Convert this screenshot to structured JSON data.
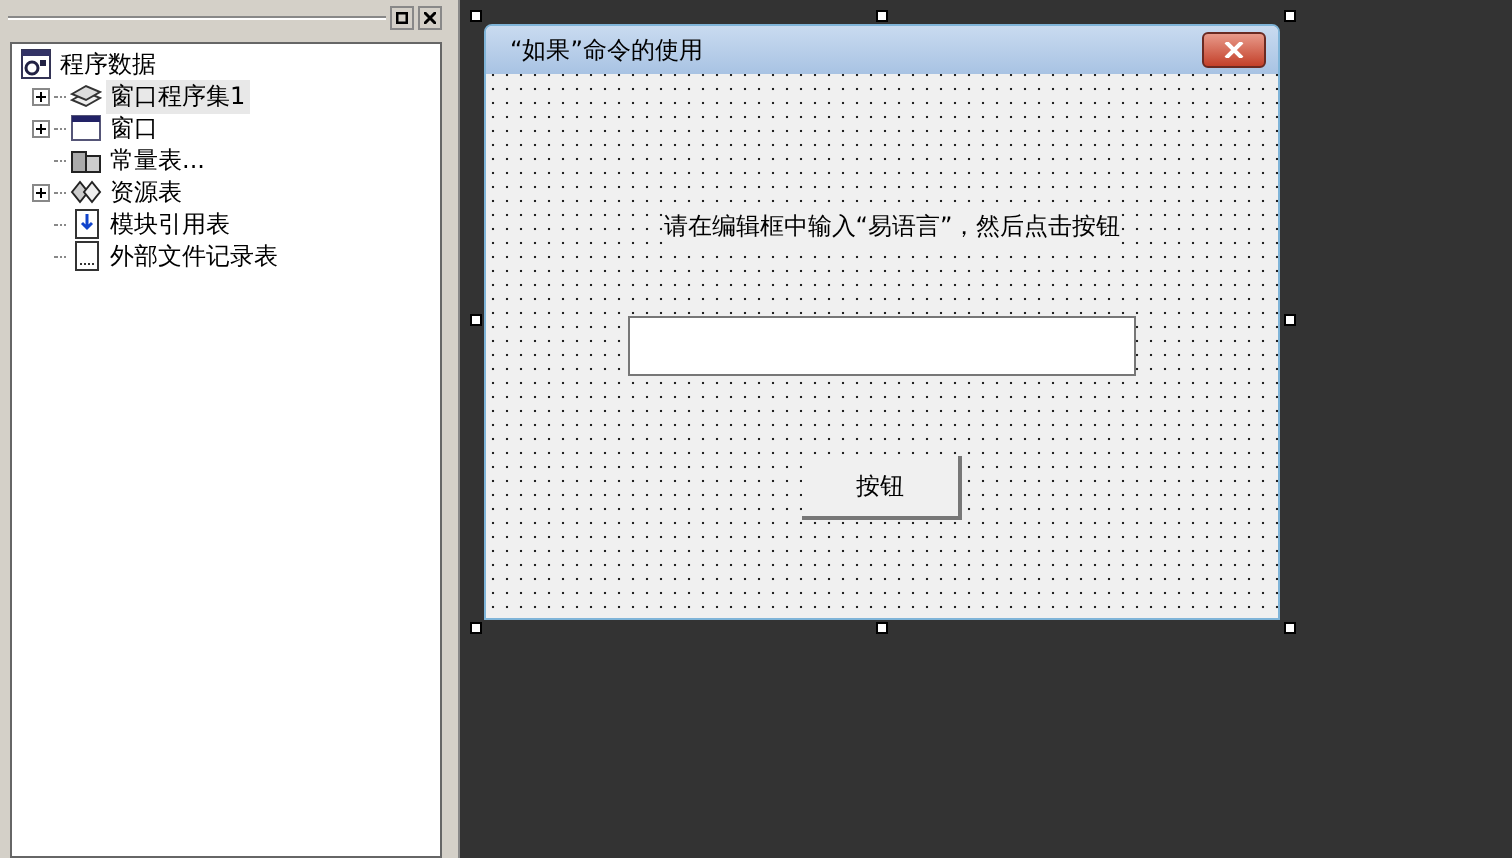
{
  "tree": {
    "root": {
      "label": "程序数据",
      "kind": "root"
    },
    "items": [
      {
        "label": "窗口程序集1",
        "kind": "module",
        "expandable": true,
        "selected": true
      },
      {
        "label": "窗口",
        "kind": "window",
        "expandable": true,
        "selected": false
      },
      {
        "label": "常量表...",
        "kind": "constants",
        "expandable": false,
        "selected": false
      },
      {
        "label": "资源表",
        "kind": "resources",
        "expandable": true,
        "selected": false
      },
      {
        "label": "模块引用表",
        "kind": "imports",
        "expandable": false,
        "selected": false
      },
      {
        "label": "外部文件记录表",
        "kind": "files",
        "expandable": false,
        "selected": false
      }
    ]
  },
  "form": {
    "title": "“如果”命令的使用",
    "label": "请在编辑框中输入“易语言”，然后点击按钮",
    "button": "按钮"
  }
}
